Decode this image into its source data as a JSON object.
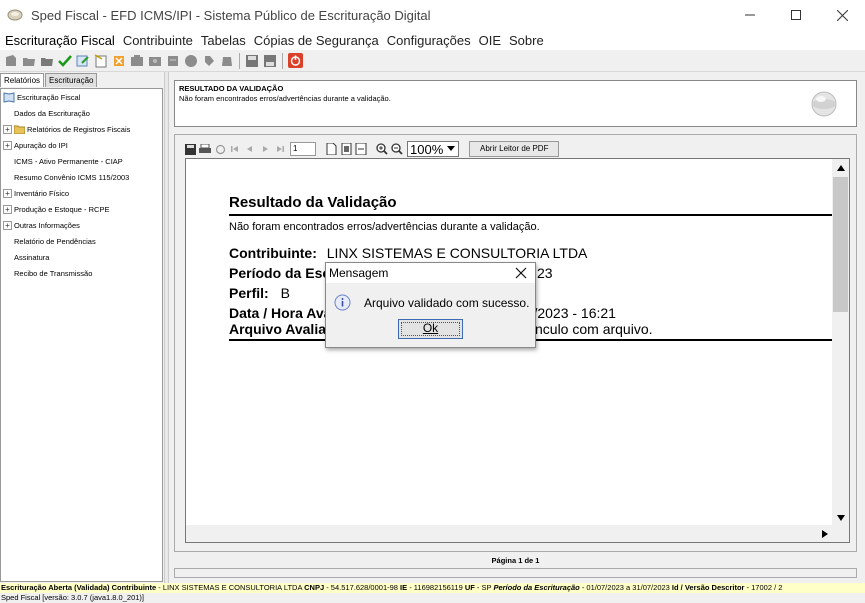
{
  "window": {
    "title": "Sped Fiscal - EFD ICMS/IPI - Sistema Público de Escrituração Digital"
  },
  "menu": [
    "Escrituração Fiscal",
    "Contribuinte",
    "Tabelas",
    "Cópias de Segurança",
    "Configurações",
    "OIE",
    "Sobre"
  ],
  "left_panel": {
    "tabs": [
      "Relatórios",
      "Escrituração"
    ],
    "tree": [
      {
        "label": "Escrituração Fiscal",
        "level": 0,
        "expander": "none",
        "icon": "book-icon"
      },
      {
        "label": "Dados da Escrituração",
        "level": 1,
        "expander": "none"
      },
      {
        "label": "Relatórios de Registros Fiscais",
        "level": 0,
        "expander": "+",
        "icon": "folder-icon"
      },
      {
        "label": "Apuração do IPI",
        "level": 0,
        "expander": "+"
      },
      {
        "label": "ICMS - Ativo Permanente - CIAP",
        "level": 1,
        "expander": "none"
      },
      {
        "label": "Resumo Convênio ICMS 115/2003",
        "level": 1,
        "expander": "none"
      },
      {
        "label": "Inventário Físico",
        "level": 0,
        "expander": "+"
      },
      {
        "label": "Produção e Estoque - RCPE",
        "level": 0,
        "expander": "+"
      },
      {
        "label": "Outras Informações",
        "level": 0,
        "expander": "+"
      },
      {
        "label": "Relatório de Pendências",
        "level": 1,
        "expander": "none"
      },
      {
        "label": "Assinatura",
        "level": 1,
        "expander": "none"
      },
      {
        "label": "Recibo de Transmissão",
        "level": 1,
        "expander": "none"
      }
    ]
  },
  "validation": {
    "title": "RESULTADO DA VALIDAÇÃO",
    "subtitle": "Não foram encontrados erros/advertências durante a validação."
  },
  "viewer": {
    "page_input": "1",
    "zoom": "100%",
    "pdf_button": "Abrir Leitor de PDF",
    "page_label": "Página 1 de 1"
  },
  "document": {
    "title": "Resultado da Validação",
    "subtitle": "Não foram encontrados erros/advertências durante a validação.",
    "contribuinte_label": "Contribuinte:",
    "contribuinte_value": "LINX SISTEMAS E CONSULTORIA LTDA",
    "periodo_label": "Período da Esc",
    "periodo_value_tail": "23",
    "perfil_label": "Perfil:",
    "perfil_value": "B",
    "data_label": "Data / Hora Ava",
    "data_value_tail": "ro/2023 - 16:21",
    "arquivo_label": "Arquivo Avaliad",
    "arquivo_value_tail": "nculo com arquivo."
  },
  "dialog": {
    "title": "Mensagem",
    "message": "Arquivo validado com sucesso.",
    "ok": "Ok"
  },
  "status": {
    "line1_a": "Escrituração Aberta (Validada) Contribuinte",
    "line1_b": " - LINX SISTEMAS E CONSULTORIA LTDA ",
    "line1_c": "CNPJ",
    "line1_d": " - 54.517.628/0001-98 ",
    "line1_e": "IE",
    "line1_f": " - 116982156119 ",
    "line1_g": "UF",
    "line1_h": " - SP ",
    "line1_i": "Período da Escrituração",
    "line1_j": " - 01/07/2023 a 31/07/2023 ",
    "line1_k": "Id / Versão Descritor",
    "line1_l": " - 17002 / 2",
    "line2": "Sped Fiscal [versão: 3.0.7 (java1.8.0_201)]"
  }
}
